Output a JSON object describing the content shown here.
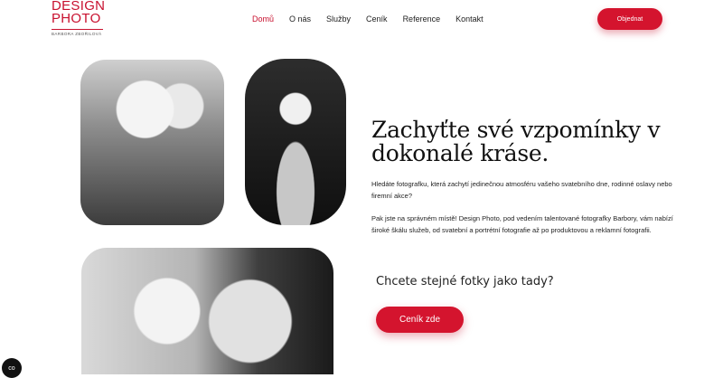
{
  "logo": {
    "line1": "DESIGN",
    "line2": "PHOTO",
    "subtitle": "BARBORA ZBOŘILOVÁ"
  },
  "nav": {
    "items": [
      {
        "label": "Domů",
        "active": true
      },
      {
        "label": "O nás",
        "active": false
      },
      {
        "label": "Služby",
        "active": false
      },
      {
        "label": "Ceník",
        "active": false
      },
      {
        "label": "Reference",
        "active": false
      },
      {
        "label": "Kontakt",
        "active": false
      }
    ],
    "cta_label": "Objednat"
  },
  "hero": {
    "headline": "Zachyťte své vzpomínky v dokonalé kráse.",
    "paragraph1": "Hledáte fotografku, která zachytí jedinečnou atmosféru vašeho svatebního dne, rodinné oslavy nebo firemní akce?",
    "paragraph2": "Pak jste na správném místě! Design Photo, pod vedením talentované fotografky Barbory, vám nabízí široké škálu služeb, od svatební a portrétní fotografie až po produktovou a reklamní fotografii.",
    "question": "Chcete stejné fotky jako tady?",
    "cta_label": "Ceník zde"
  },
  "cookie_badge": {
    "label": "co"
  },
  "colors": {
    "accent": "#d4142e",
    "text": "#111111",
    "background": "#ffffff"
  }
}
